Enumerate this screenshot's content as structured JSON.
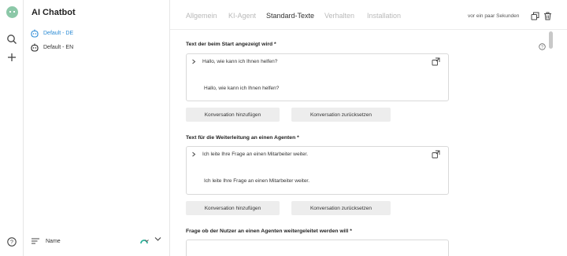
{
  "app": {
    "title": "AI Chatbot"
  },
  "rail": {
    "icons": [
      "logo-icon",
      "search-icon",
      "plus-icon",
      "help-icon"
    ]
  },
  "sidebar": {
    "items": [
      {
        "label": "Default - DE",
        "active": true
      },
      {
        "label": "Default - EN",
        "active": false
      }
    ],
    "bottom": {
      "label": "Name"
    }
  },
  "header": {
    "tabs": [
      {
        "label": "Allgemein",
        "active": false
      },
      {
        "label": "KI-Agent",
        "active": false
      },
      {
        "label": "Standard-Texte",
        "active": true
      },
      {
        "label": "Verhalten",
        "active": false
      },
      {
        "label": "Installation",
        "active": false
      }
    ],
    "timestamp": "vor ein paar Sekunden"
  },
  "sections": [
    {
      "title": "Text der beim Start angezeigt wird *",
      "collapsed_text": "Hallo, wie kann ich Ihnen helfen?",
      "body_text": "Hallo, wie kann ich Ihnen helfen?",
      "add_label": "Konversation hinzufügen",
      "reset_label": "Konversation zurücksetzen"
    },
    {
      "title": "Text für die Weiterleitung an einen Agenten *",
      "collapsed_text": "Ich leite Ihre Frage an einen Mitarbeiter weiter.",
      "body_text": "Ich leite Ihre Frage an einen Mitarbeiter weiter.",
      "add_label": "Konversation hinzufügen",
      "reset_label": "Konversation zurücksetzen"
    },
    {
      "title": "Frage ob der Nutzer an einen Agenten weitergeleitet werden will *"
    }
  ],
  "colors": {
    "accent": "#2a8ad4",
    "logo": "#8cc8a8",
    "theme_icon": "#2bb39a"
  }
}
